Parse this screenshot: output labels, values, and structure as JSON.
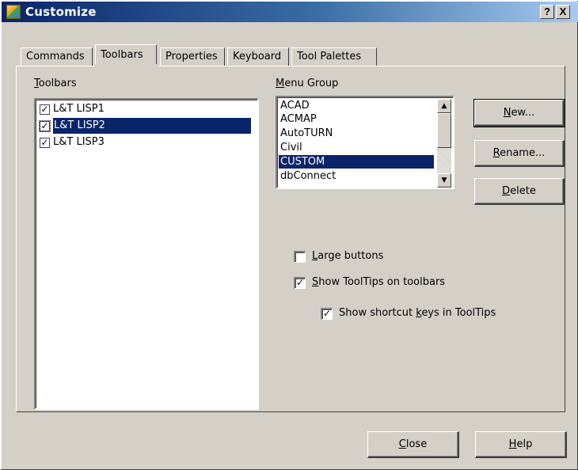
{
  "window": {
    "title": "Customize",
    "help_caption": "?",
    "close_caption": "X"
  },
  "tabs": [
    {
      "label": "Commands",
      "active": false
    },
    {
      "label": "Toolbars",
      "active": true
    },
    {
      "label": "Properties",
      "active": false
    },
    {
      "label": "Keyboard",
      "active": false
    },
    {
      "label": "Tool Palettes",
      "active": false
    }
  ],
  "toolbars": {
    "label_mnemonic": "T",
    "label_rest": "oolbars",
    "items": [
      {
        "label": "L&T LISP1",
        "checked": true,
        "selected": false
      },
      {
        "label": "L&T LISP2",
        "checked": true,
        "selected": true
      },
      {
        "label": "L&T LISP3",
        "checked": true,
        "selected": false
      }
    ],
    "check_glyph": "✓"
  },
  "menu_group": {
    "label_mnemonic": "M",
    "label_rest": "enu Group",
    "items": [
      {
        "label": "ACAD",
        "selected": false
      },
      {
        "label": "ACMAP",
        "selected": false
      },
      {
        "label": "AutoTURN",
        "selected": false
      },
      {
        "label": "Civil",
        "selected": false
      },
      {
        "label": "CUSTOM",
        "selected": true
      },
      {
        "label": "dbConnect",
        "selected": false
      }
    ],
    "scroll_up": "▲",
    "scroll_down": "▼"
  },
  "side_buttons": {
    "new": {
      "mnemonic": "N",
      "rest": "ew..."
    },
    "rename": {
      "mnemonic": "R",
      "rest": "ename..."
    },
    "delete": {
      "mnemonic": "D",
      "rest": "elete"
    }
  },
  "options": {
    "large_buttons": {
      "mnemonic": "L",
      "rest": "arge buttons",
      "checked": false
    },
    "show_tooltips": {
      "mnemonic": "S",
      "rest": "how ToolTips on toolbars",
      "checked": true
    },
    "show_shortcut_keys": {
      "before": "Show shortcut ",
      "mnemonic": "k",
      "rest": "eys in ToolTips",
      "checked": true
    },
    "check_glyph": "✓"
  },
  "footer": {
    "close": {
      "mnemonic": "C",
      "rest": "lose"
    },
    "help": {
      "mnemonic": "H",
      "rest": "elp"
    }
  },
  "colors": {
    "face": "#d4d0c8",
    "selection": "#0a246a",
    "title_start": "#0a246a",
    "title_end": "#a6caf0"
  }
}
